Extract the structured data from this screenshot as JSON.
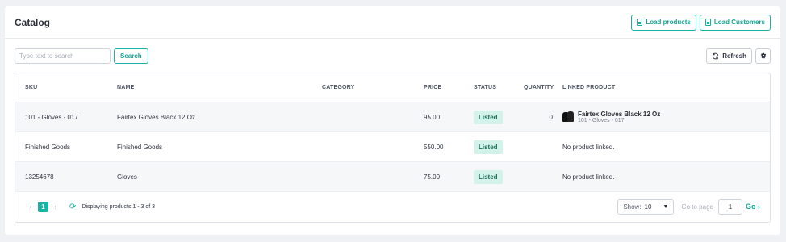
{
  "header": {
    "title": "Catalog",
    "load_products_label": "Load products",
    "load_customers_label": "Load Customers"
  },
  "toolbar": {
    "search_placeholder": "Type text to search",
    "search_value": "",
    "search_label": "Search",
    "refresh_label": "Refresh"
  },
  "table": {
    "columns": {
      "sku": "SKU",
      "name": "NAME",
      "category": "CATEGORY",
      "price": "PRICE",
      "status": "STATUS",
      "quantity": "QUANTITY",
      "linked": "LINKED PRODUCT"
    },
    "rows": [
      {
        "sku": "101 - Gloves - 017",
        "name": "Fairtex Gloves Black 12 Oz",
        "category": "",
        "price": "95.00",
        "status": "Listed",
        "quantity": "0",
        "linked_title": "Fairtex Gloves Black 12 Oz",
        "linked_sub": "101 - Gloves - 017"
      },
      {
        "sku": "Finished Goods",
        "name": "Finished Goods",
        "category": "",
        "price": "550.00",
        "status": "Listed",
        "quantity": "",
        "linked_text": "No product linked."
      },
      {
        "sku": "13254678",
        "name": "Gloves",
        "category": "",
        "price": "75.00",
        "status": "Listed",
        "quantity": "",
        "linked_text": "No product linked."
      }
    ]
  },
  "footer": {
    "prev_icon": "chevron-left-icon",
    "current_page": "1",
    "next_icon": "chevron-right-icon",
    "displaying": "Displaying products 1 - 3 of 3",
    "show_label": "Show:",
    "show_value": "10",
    "goto_label": "Go to page",
    "goto_value": "1",
    "go_label": "Go"
  },
  "colors": {
    "accent": "#17b3a3",
    "badge_bg": "#d3f2ea",
    "page_bg": "#f0f1f4"
  }
}
